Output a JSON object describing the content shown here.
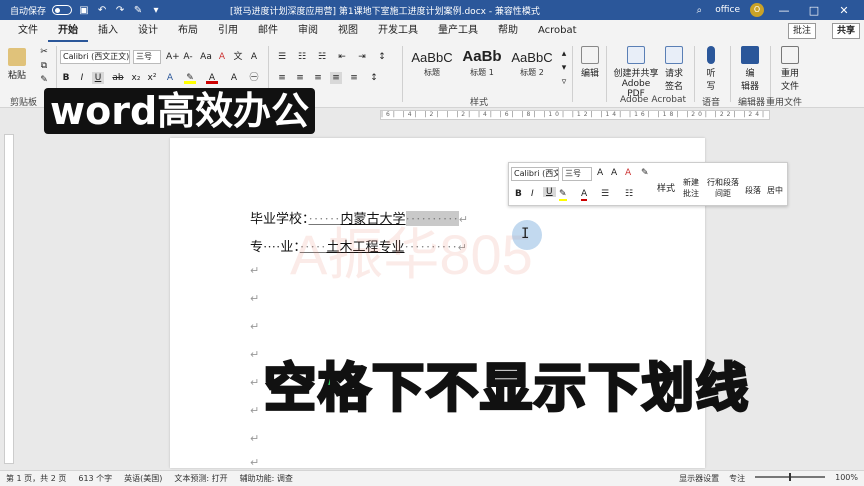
{
  "titlebar": {
    "autosave": "自动保存",
    "doc_title": "[斑马进度计划深度应用营] 第1课地下室施工进度计划案例.docx - 兼容性模式",
    "search_icon": "search-icon",
    "user": "office",
    "avatar": "O",
    "min": "—",
    "restore": "□",
    "close": "✕"
  },
  "tabs": [
    "文件",
    "开始",
    "插入",
    "设计",
    "布局",
    "引用",
    "邮件",
    "审阅",
    "视图",
    "开发工具",
    "量产工具",
    "帮助",
    "Acrobat"
  ],
  "active_tab": "开始",
  "comment_label": "批注",
  "share_label": "共享",
  "ribbon": {
    "paste": "粘贴",
    "clipboard": "剪贴板",
    "font_name": "Calibri (西文正文)",
    "font_size": "三号",
    "grow": "A+",
    "shrink": "A-",
    "aa": "Aa",
    "clear": "A",
    "bold": "B",
    "italic": "I",
    "underline": "U",
    "strike": "ab",
    "sub": "x₂",
    "sup": "x²",
    "styles": [
      {
        "sample": "AaBbC",
        "name": "标题"
      },
      {
        "sample": "AaBb",
        "name": "标题 1"
      },
      {
        "sample": "AaBbC",
        "name": "标题 2"
      }
    ],
    "styles_group": "样式",
    "edit": "编辑",
    "create_pdf": "创建并共享\nAdobe PDF",
    "request_sign": "请求\n签名",
    "acrobat_group": "Adobe Acrobat",
    "dictate": "听\n写",
    "voice_group": "语音",
    "editor": "编\n辑器",
    "editor_group": "编辑器",
    "reuse": "重用\n文件",
    "reuse_group": "重用文件"
  },
  "ruler_ticks": "|6| |4| |2| | |2| |4| |6| |8| |10| |12| |14| |16| |18| |20| |22| |24| |26| |28| |30| |32| |34| |36| |38| |40| |42|",
  "document": {
    "line1_label": "毕业学校：",
    "line1_dots": "······",
    "line1_value": "内蒙古大学",
    "line1_trail": "··········",
    "line2_label": "专····业：",
    "line2_dots": "·····",
    "line2_value": "土木工程专业",
    "line2_trail": "··········",
    "para_mark": "↵",
    "watermark": "A振华805"
  },
  "mini_toolbar": {
    "font": "Calibri (西文正",
    "size": "三号",
    "grow": "A",
    "shrink": "A",
    "styles": "样式",
    "new_comment": "新建\n批注",
    "line_spacing": "行和段落\n间距",
    "paragraph": "段落",
    "center": "居中",
    "bold": "B",
    "italic": "I",
    "underline": "U"
  },
  "overlay": {
    "top": "word高效办公",
    "bottom": "空格下不显示下划线"
  },
  "statusbar": {
    "page": "第 1 页，共 2 页",
    "words": "613 个字",
    "lang": "英语(美国)",
    "predict": "文本预测: 打开",
    "access": "辅助功能: 调查",
    "display": "显示器设置",
    "focus": "专注",
    "zoom": "100%"
  }
}
